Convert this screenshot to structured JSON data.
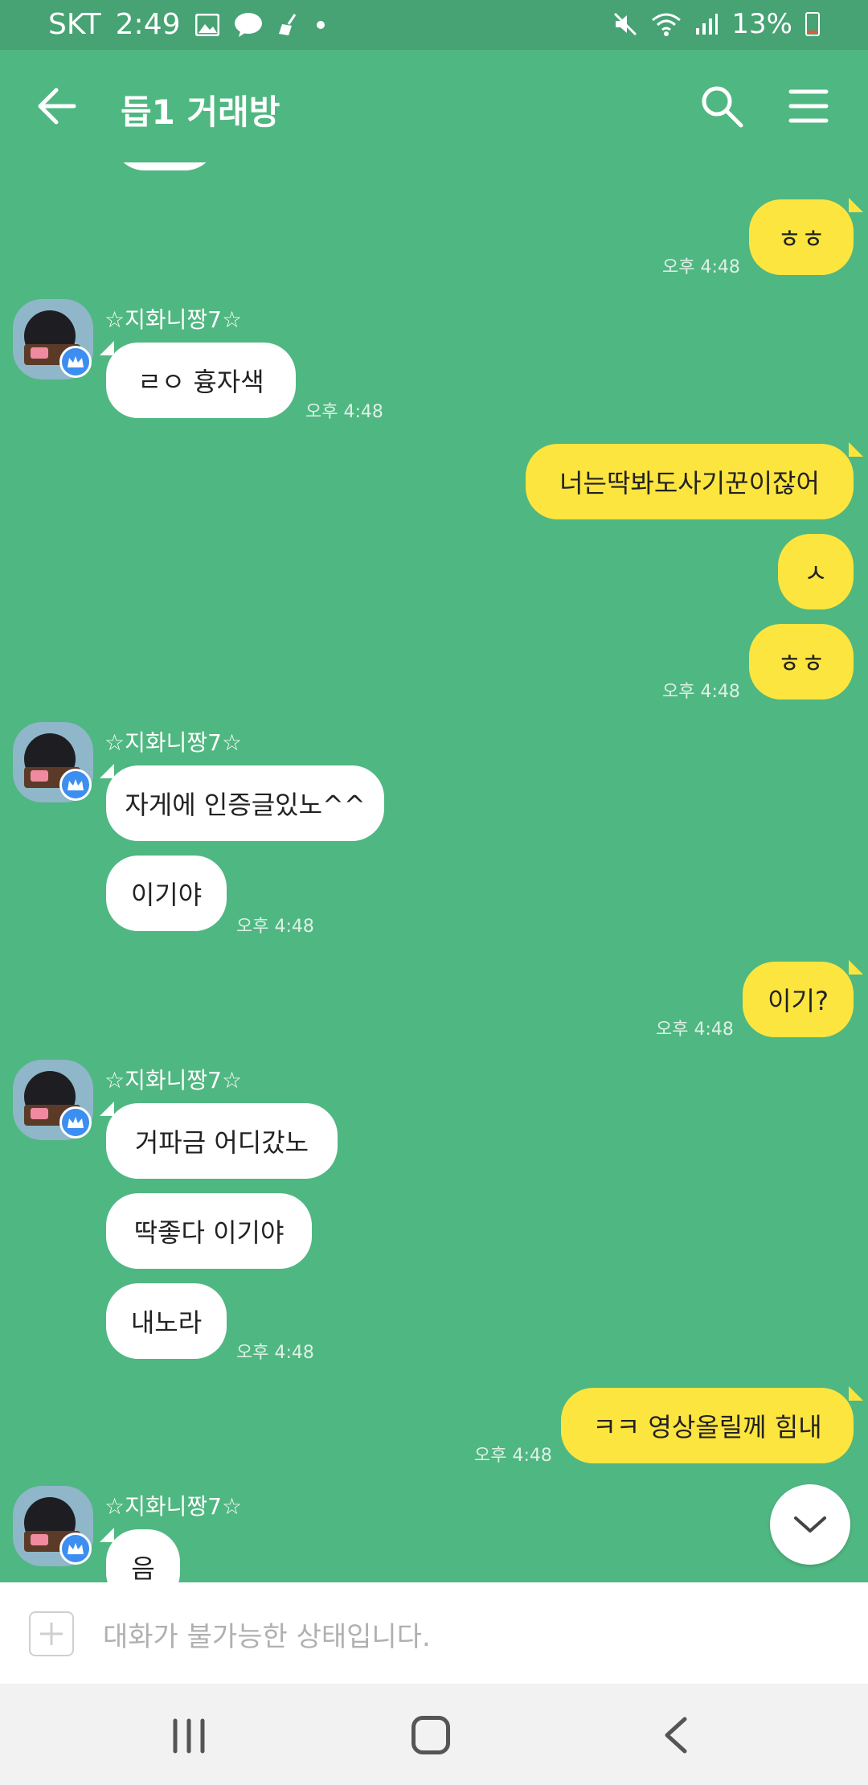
{
  "status_bar": {
    "carrier": "SKT",
    "time": "2:49",
    "battery": "13%",
    "icons_left": [
      "gallery-icon",
      "talk-icon",
      "broom-icon",
      "dot-icon"
    ],
    "icons_right": [
      "mute-icon",
      "wifi-icon",
      "signal-icon",
      "battery-icon"
    ]
  },
  "header": {
    "title": "듭1 거래방"
  },
  "messages": [
    {
      "side": "me",
      "text": "ㅎㅎ",
      "time": "오후 4:48"
    },
    {
      "side": "other",
      "sender": "☆지화니짱7☆",
      "text": "ㄹㅇ 흉자색",
      "time": "오후 4:48"
    },
    {
      "side": "me",
      "text": "너는딱봐도사기꾼이잖어",
      "time": ""
    },
    {
      "side": "me",
      "text": "ㅅ",
      "time": ""
    },
    {
      "side": "me",
      "text": "ㅎㅎ",
      "time": "오후 4:48"
    },
    {
      "side": "other",
      "sender": "☆지화니짱7☆",
      "text": "자게에 인증글있노^^",
      "time": ""
    },
    {
      "side": "other",
      "text": "이기야",
      "time": "오후 4:48"
    },
    {
      "side": "me",
      "text": "이기?",
      "time": "오후 4:48"
    },
    {
      "side": "other",
      "sender": "☆지화니짱7☆",
      "text": "거파금 어디갔노",
      "time": ""
    },
    {
      "side": "other",
      "text": "딱좋다 이기야",
      "time": ""
    },
    {
      "side": "other",
      "text": "내노라",
      "time": "오후 4:48"
    },
    {
      "side": "me",
      "text": "ㅋㅋ 영상올릴께 힘내",
      "time": "오후 4:48"
    },
    {
      "side": "other",
      "sender": "☆지화니짱7☆",
      "text": "음",
      "time": ""
    }
  ],
  "input": {
    "placeholder": "대화가 불가능한 상태입니다."
  },
  "colors": {
    "background": "#4fb781",
    "status_bar": "#47a274",
    "my_bubble": "#fde53f",
    "other_bubble": "#ffffff"
  }
}
